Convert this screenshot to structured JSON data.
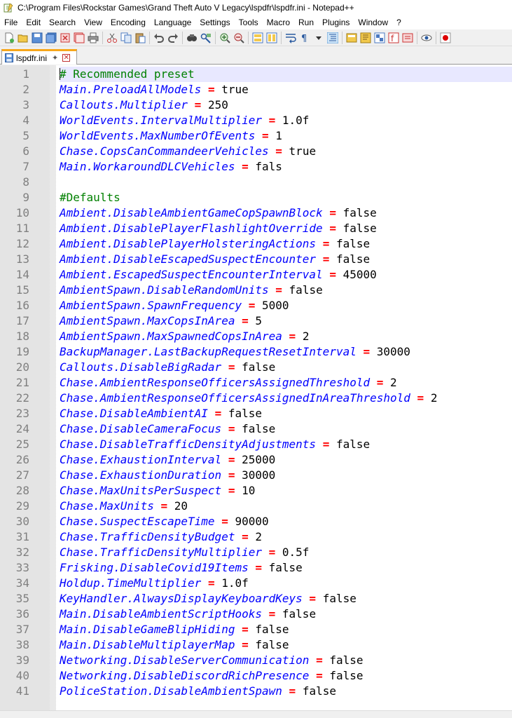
{
  "window": {
    "title": "C:\\Program Files\\Rockstar Games\\Grand Theft Auto V Legacy\\lspdfr\\lspdfr.ini - Notepad++"
  },
  "menu": [
    "File",
    "Edit",
    "Search",
    "View",
    "Encoding",
    "Language",
    "Settings",
    "Tools",
    "Macro",
    "Run",
    "Plugins",
    "Window",
    "?"
  ],
  "toolbar": {
    "buttons": [
      "new-file-icon",
      "open-file-icon",
      "save-icon",
      "save-all-icon",
      "close-icon",
      "close-all-icon",
      "print-icon",
      "sep",
      "cut-icon",
      "copy-icon",
      "paste-icon",
      "sep",
      "undo-icon",
      "redo-icon",
      "sep",
      "find-icon",
      "replace-icon",
      "sep",
      "zoom-in-icon",
      "zoom-out-icon",
      "sep",
      "sync-vertical-icon",
      "sync-horizontal-icon",
      "sep",
      "word-wrap-icon",
      "show-all-chars-icon",
      "dropdown-arrow-icon",
      "indent-guide-icon",
      "sep",
      "user-language-icon",
      "doc-map-icon",
      "function-list-icon",
      "folder-workspace-icon",
      "document-list-icon",
      "sep",
      "monitor-icon",
      "sep",
      "record-macro-icon"
    ]
  },
  "tab": {
    "label": "lspdfr.ini"
  },
  "editor": {
    "lines": [
      {
        "n": "1",
        "comment": "# Recommended preset"
      },
      {
        "n": "2",
        "key": "Main.PreloadAllModels",
        "value": "true"
      },
      {
        "n": "3",
        "key": "Callouts.Multiplier",
        "value": "250"
      },
      {
        "n": "4",
        "key": "WorldEvents.IntervalMultiplier",
        "value": "1.0f"
      },
      {
        "n": "5",
        "key": "WorldEvents.MaxNumberOfEvents",
        "value": "1"
      },
      {
        "n": "6",
        "key": "Chase.CopsCanCommandeerVehicles",
        "value": "true"
      },
      {
        "n": "7",
        "key": "Main.WorkaroundDLCVehicles",
        "value": "fals"
      },
      {
        "n": "8"
      },
      {
        "n": "9",
        "comment": "#Defaults"
      },
      {
        "n": "10",
        "key": "Ambient.DisableAmbientGameCopSpawnBlock",
        "value": "false"
      },
      {
        "n": "11",
        "key": "Ambient.DisablePlayerFlashlightOverride",
        "value": "false"
      },
      {
        "n": "12",
        "key": "Ambient.DisablePlayerHolsteringActions",
        "value": "false"
      },
      {
        "n": "13",
        "key": "Ambient.DisableEscapedSuspectEncounter",
        "value": "false"
      },
      {
        "n": "14",
        "key": "Ambient.EscapedSuspectEncounterInterval",
        "value": "45000"
      },
      {
        "n": "15",
        "key": "AmbientSpawn.DisableRandomUnits",
        "value": "false"
      },
      {
        "n": "16",
        "key": "AmbientSpawn.SpawnFrequency",
        "value": "5000"
      },
      {
        "n": "17",
        "key": "AmbientSpawn.MaxCopsInArea",
        "value": "5"
      },
      {
        "n": "18",
        "key": "AmbientSpawn.MaxSpawnedCopsInArea",
        "value": "2"
      },
      {
        "n": "19",
        "key": "BackupManager.LastBackupRequestResetInterval",
        "value": "30000"
      },
      {
        "n": "20",
        "key": "Callouts.DisableBigRadar",
        "value": "false"
      },
      {
        "n": "21",
        "key": "Chase.AmbientResponseOfficersAssignedThreshold",
        "value": "2"
      },
      {
        "n": "22",
        "key": "Chase.AmbientResponseOfficersAssignedInAreaThreshold",
        "value": "2"
      },
      {
        "n": "23",
        "key": "Chase.DisableAmbientAI",
        "value": "false"
      },
      {
        "n": "24",
        "key": "Chase.DisableCameraFocus",
        "value": "false"
      },
      {
        "n": "25",
        "key": "Chase.DisableTrafficDensityAdjustments",
        "value": "false"
      },
      {
        "n": "26",
        "key": "Chase.ExhaustionInterval",
        "value": "25000"
      },
      {
        "n": "27",
        "key": "Chase.ExhaustionDuration",
        "value": "30000"
      },
      {
        "n": "28",
        "key": "Chase.MaxUnitsPerSuspect",
        "value": "10"
      },
      {
        "n": "29",
        "key": "Chase.MaxUnits",
        "value": "20"
      },
      {
        "n": "30",
        "key": "Chase.SuspectEscapeTime",
        "value": "90000"
      },
      {
        "n": "31",
        "key": "Chase.TrafficDensityBudget",
        "value": "2"
      },
      {
        "n": "32",
        "key": "Chase.TrafficDensityMultiplier",
        "value": "0.5f"
      },
      {
        "n": "33",
        "key": "Frisking.DisableCovid19Items",
        "value": "false"
      },
      {
        "n": "34",
        "key": "Holdup.TimeMultiplier",
        "value": "1.0f"
      },
      {
        "n": "35",
        "key": "KeyHandler.AlwaysDisplayKeyboardKeys",
        "value": "false"
      },
      {
        "n": "36",
        "key": "Main.DisableAmbientScriptHooks",
        "value": "false"
      },
      {
        "n": "37",
        "key": "Main.DisableGameBlipHiding",
        "value": "false"
      },
      {
        "n": "38",
        "key": "Main.DisableMultiplayerMap",
        "value": "false"
      },
      {
        "n": "39",
        "key": "Networking.DisableServerCommunication",
        "value": "false"
      },
      {
        "n": "40",
        "key": "Networking.DisableDiscordRichPresence",
        "value": "false"
      },
      {
        "n": "41",
        "key": "PoliceStation.DisableAmbientSpawn",
        "value": "false"
      }
    ]
  }
}
